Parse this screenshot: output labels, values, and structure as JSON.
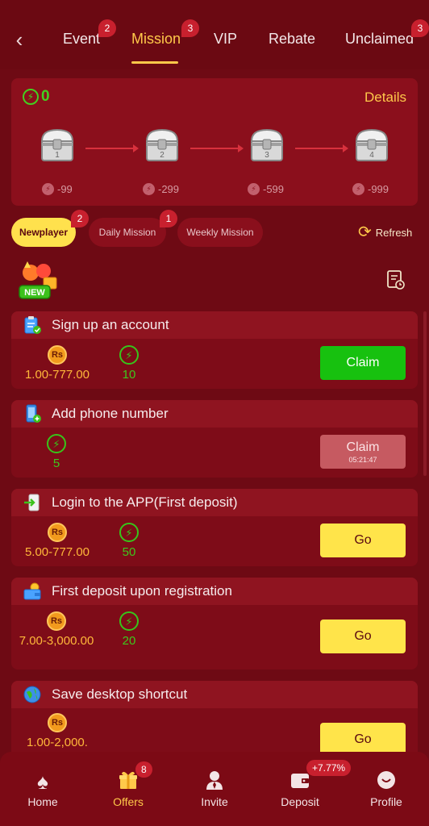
{
  "tabs": [
    {
      "label": "Event",
      "badge": "2"
    },
    {
      "label": "Mission",
      "badge": "3"
    },
    {
      "label": "VIP"
    },
    {
      "label": "Rebate"
    },
    {
      "label": "Unclaimed",
      "badge": "3"
    }
  ],
  "chest_panel": {
    "energy_total": "0",
    "details_label": "Details",
    "chests": [
      {
        "number": "1",
        "cost": "-99"
      },
      {
        "number": "2",
        "cost": "-299"
      },
      {
        "number": "3",
        "cost": "-599"
      },
      {
        "number": "4",
        "cost": "-999"
      }
    ]
  },
  "filters": [
    {
      "label": "Newplayer",
      "badge": "2"
    },
    {
      "label": "Daily Mission",
      "badge": "1"
    },
    {
      "label": "Weekly Mission"
    }
  ],
  "refresh_label": "Refresh",
  "new_logo_text": "NEW",
  "missions": [
    {
      "title": "Sign up an account",
      "coin_label": "Rs",
      "cash": "1.00-777.00",
      "energy": "10",
      "button": "Claim",
      "icon": "clipboard-icon"
    },
    {
      "title": "Add phone number",
      "energy": "5",
      "button": "Claim",
      "countdown": "05:21:47",
      "icon": "phone-icon"
    },
    {
      "title": "Login to the APP(First deposit)",
      "coin_label": "Rs",
      "cash": "5.00-777.00",
      "energy": "50",
      "button": "Go",
      "icon": "login-icon"
    },
    {
      "title": "First deposit upon registration",
      "coin_label": "Rs",
      "cash": "7.00-3,000.00",
      "energy": "20",
      "button": "Go",
      "icon": "wallet-icon"
    },
    {
      "title": "Save desktop shortcut",
      "coin_label": "Rs",
      "cash": "1.00-2,000.",
      "button": "Go",
      "icon": "globe-icon"
    }
  ],
  "bottom_nav": [
    {
      "label": "Home",
      "icon": "spade-icon"
    },
    {
      "label": "Offers",
      "icon": "gift-icon",
      "badge": "8"
    },
    {
      "label": "Invite",
      "icon": "person-icon"
    },
    {
      "label": "Deposit",
      "icon": "wallet-icon",
      "badge": "+7.77%"
    },
    {
      "label": "Profile",
      "icon": "face-icon"
    }
  ],
  "colors": {
    "background": "#6e0a14",
    "accent_gold": "#ffc94a",
    "energy_green": "#43d020",
    "claim_green": "#17c10f",
    "go_yellow": "#ffe44a"
  }
}
